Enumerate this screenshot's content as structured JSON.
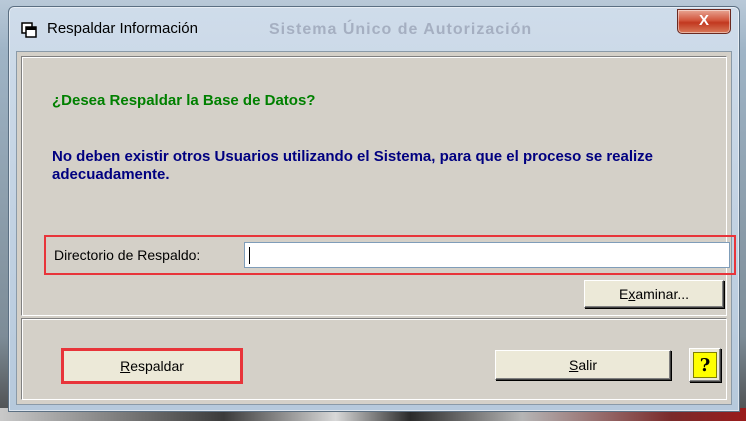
{
  "window": {
    "title": "Respaldar Información",
    "background_title": "Sistema Único de Autorización",
    "close_label": "X"
  },
  "prompt": {
    "question": "¿Desea Respaldar la Base de Datos?",
    "warning": "No deben existir otros Usuarios utilizando el Sistema, para que el proceso se realize adecuadamente."
  },
  "backup_dir": {
    "label": "Directorio de Respaldo:",
    "value": ""
  },
  "buttons": {
    "browse_pre": "E",
    "browse_key": "x",
    "browse_post": "aminar...",
    "backup_key": "R",
    "backup_post": "espaldar",
    "exit_key": "S",
    "exit_post": "alir",
    "help_glyph": "?"
  },
  "colors": {
    "question_text": "#008000",
    "warning_text": "#000080",
    "highlight": "#e8343a"
  },
  "icons": {
    "window": "window-copy-icon",
    "help": "question-mark-icon"
  }
}
